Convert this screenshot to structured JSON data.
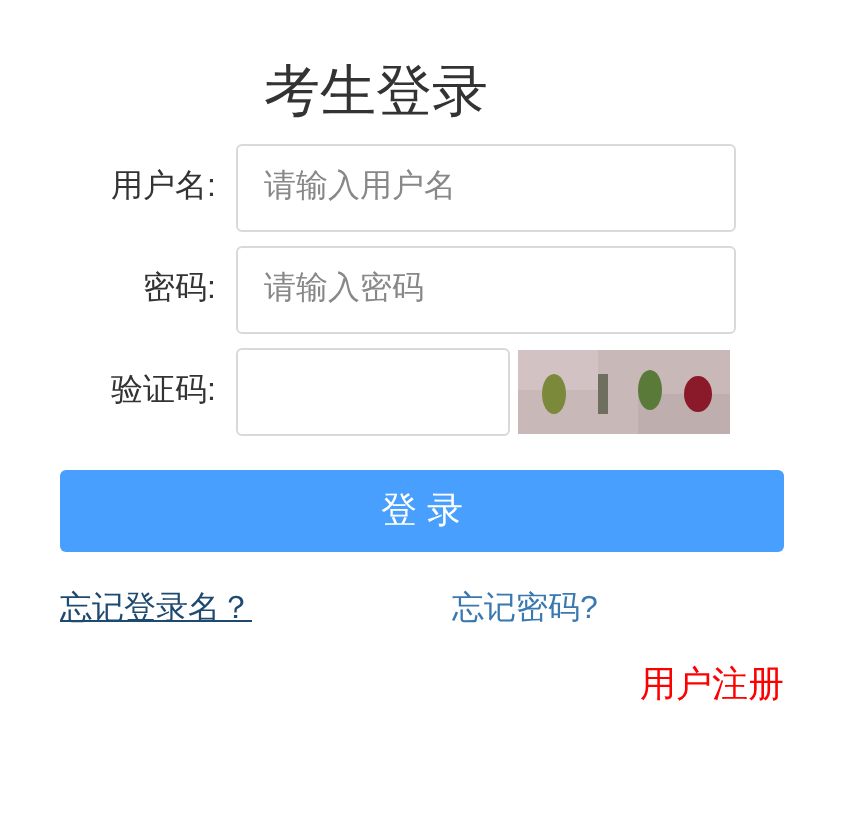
{
  "title": "考生登录",
  "fields": [
    {
      "label": "用户名:",
      "placeholder": "请输入用户名",
      "kind": "text"
    },
    {
      "label": "密码:",
      "placeholder": "请输入密码",
      "kind": "text"
    },
    {
      "label": "验证码:",
      "kind": "captcha"
    }
  ],
  "login_button": "登 录",
  "links": [
    {
      "label": "忘记登录名？",
      "underlined": true
    },
    {
      "label": "忘记密码?",
      "underlined": false
    }
  ],
  "register_link": "用户注册"
}
